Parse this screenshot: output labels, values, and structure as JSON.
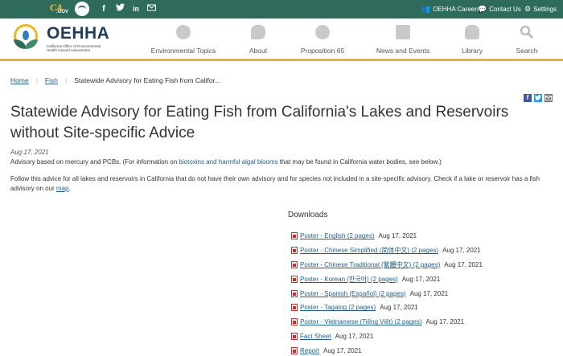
{
  "topbar": {
    "cagov_logo": "CA.GOV",
    "social_icons": [
      "facebook-icon",
      "twitter-icon",
      "linkedin-icon",
      "email-icon"
    ],
    "links": [
      {
        "icon": "people-icon",
        "label": "OEHHA Careers"
      },
      {
        "icon": "chat-icon",
        "label": "Contact Us"
      },
      {
        "icon": "gear-icon",
        "label": "Settings"
      }
    ]
  },
  "header": {
    "brand": "OEHHA",
    "brand_sub": "California Office of Environmental Health Hazard Assessment",
    "nav": [
      {
        "icon": "leaf-icon",
        "label": "Environmental Topics"
      },
      {
        "icon": "speech-bubble-icon",
        "label": "About"
      },
      {
        "icon": "prop65-icon",
        "label": "Proposition 65"
      },
      {
        "icon": "calendar-icon",
        "label": "News and Events"
      },
      {
        "icon": "hand-pointer-icon",
        "label": "Library"
      },
      {
        "icon": "search-icon",
        "label": "Search"
      }
    ]
  },
  "breadcrumb": {
    "home": "Home",
    "fish": "Fish",
    "current": "Statewide Advisory for Eating Fish from Califor..."
  },
  "page": {
    "title": "Statewide Advisory for Eating Fish from California's Lakes and Reservoirs without Site-specific Advice",
    "date": "Aug 17, 2021",
    "p1_a": "Advisory based on mercury and PCBs. (For information on ",
    "p1_link": "biotoxins and harmful algal blooms",
    "p1_b": " that may be found in California water bodies, see below.)",
    "p2_a": "Follow this advice for all lakes and reservoirs in California that do not have their own advisory and for species not included in a site-specific advisory. Check if a lake or reservoir has a fish advisory on our ",
    "p2_link": "map",
    "p2_b": "."
  },
  "downloads": {
    "title": "Downloads",
    "items": [
      {
        "label": "Poster - English (2 pages)",
        "date": "Aug 17, 2021"
      },
      {
        "label": "Poster - Chinese Simplified (简体中文) (2 pages)",
        "date": "Aug 17, 2021"
      },
      {
        "label": "Poster - Chinese Traditional (繁體中文) (2 pages)",
        "date": "Aug 17, 2021"
      },
      {
        "label": "Poster - Korean (한국어) (2 pages)",
        "date": "Aug 17, 2021"
      },
      {
        "label": "Poster - Spanish (Español) (2 pages)",
        "date": "Aug 17, 2021"
      },
      {
        "label": "Poster - Tagalog (2 pages)",
        "date": "Aug 17, 2021"
      },
      {
        "label": "Poster - Vietnamese (Tiếng Việt) (2 pages)",
        "date": "Aug 17, 2021"
      },
      {
        "label": "Fact Sheet",
        "date": "Aug 17, 2021"
      },
      {
        "label": "Report",
        "date": "Aug 17, 2021"
      }
    ]
  },
  "colors": {
    "topbar": "#2e6b5a",
    "accent_gold": "#e2b53a",
    "link": "#1f5e8e",
    "pdf_red": "#c9302c"
  }
}
